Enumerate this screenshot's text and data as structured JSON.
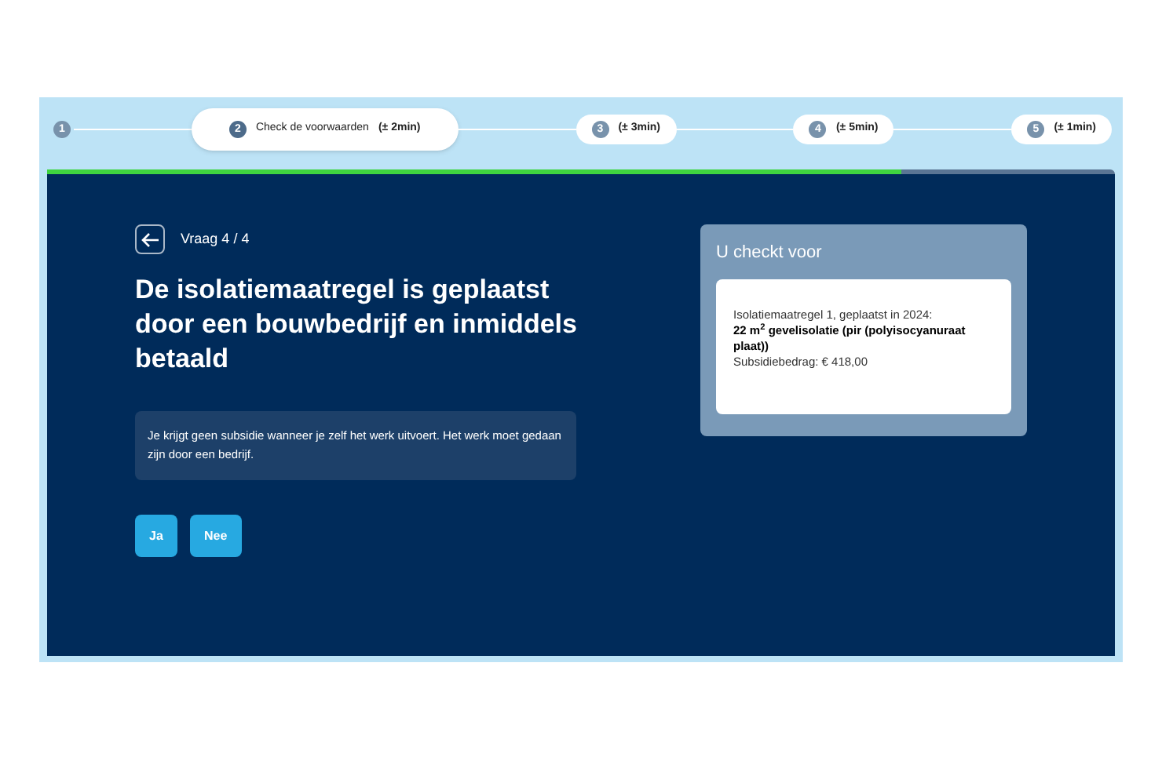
{
  "steps": [
    {
      "number": "1",
      "selected": false
    },
    {
      "number": "2",
      "label": "Check de voorwaarden",
      "duration": "(± 2min)",
      "selected": true
    },
    {
      "number": "3",
      "duration": "(± 3min)",
      "selected": false
    },
    {
      "number": "4",
      "duration": "(± 5min)",
      "selected": false
    },
    {
      "number": "5",
      "duration": "(± 1min)",
      "selected": false
    }
  ],
  "progress": {
    "level": 0.8
  },
  "question": {
    "counter": "Vraag 4 / 4",
    "title": "De isolatiemaatregel is geplaatst door een bouwbedrijf en inmiddels betaald",
    "hint": "Je krijgt geen subsidie wanneer je zelf het werk uitvoert. Het werk moet gedaan zijn door een bedrijf.",
    "answers": [
      "Ja",
      "Nee"
    ]
  },
  "summary": {
    "title": "U checkt voor",
    "lines": [
      {
        "kind": "plain",
        "text": "Isolatiemaatregel 1, geplaatst in 2024:"
      },
      {
        "kind": "bold",
        "text": "22 m$^{2}$ gevelisolatie (pir (polyisocyanuraat plaat))"
      },
      {
        "kind": "plain",
        "text": "Subsidiebedrag: € 418,00"
      }
    ]
  }
}
